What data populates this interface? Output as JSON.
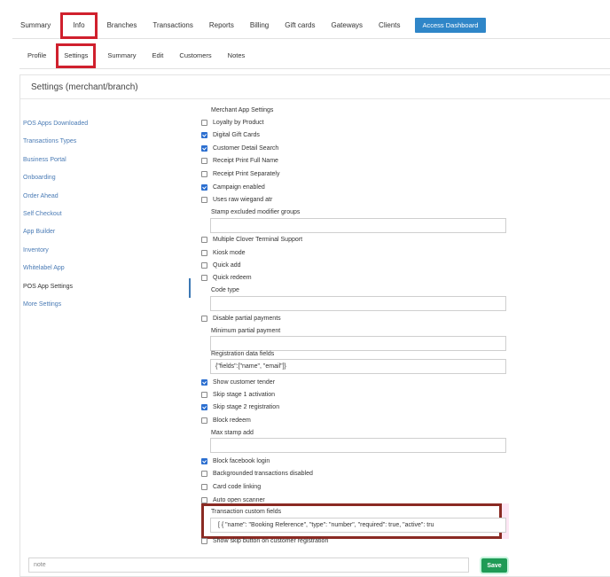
{
  "top_nav": {
    "tabs": [
      "Summary",
      "Info",
      "Branches",
      "Transactions",
      "Reports",
      "Billing",
      "Gift cards",
      "Gateways",
      "Clients"
    ],
    "active": "Info",
    "access_button": "Access Dashboard"
  },
  "sub_nav": {
    "tabs": [
      "Profile",
      "Settings",
      "Summary",
      "Edit",
      "Customers",
      "Notes"
    ],
    "active": "Settings"
  },
  "panel": {
    "title": "Settings (merchant/branch)"
  },
  "sidebar": {
    "items": [
      "POS Apps Downloaded",
      "Transactions Types",
      "Business Portal",
      "Onboarding",
      "Order Ahead",
      "Self Checkout",
      "App Builder",
      "Inventory",
      "Whitelabel App",
      "POS App Settings",
      "More Settings"
    ],
    "current": "POS App Settings"
  },
  "settings": {
    "section_title": "Merchant App Settings",
    "checkboxes": [
      {
        "label": "Loyalty by Product",
        "checked": false
      },
      {
        "label": "Digital Gift Cards",
        "checked": true
      },
      {
        "label": "Customer Detail Search",
        "checked": true
      },
      {
        "label": "Receipt Print Full Name",
        "checked": false
      },
      {
        "label": "Receipt Print Separately",
        "checked": false
      },
      {
        "label": "Campaign enabled",
        "checked": true
      },
      {
        "label": "Uses raw wiegand atr",
        "checked": false
      },
      {
        "label": "Multiple Clover Terminal Support",
        "checked": false
      },
      {
        "label": "Kiosk mode",
        "checked": false
      },
      {
        "label": "Quick add",
        "checked": false
      },
      {
        "label": "Quick redeem",
        "checked": false
      },
      {
        "label": "Disable partial payments",
        "checked": false
      },
      {
        "label": "Show customer tender",
        "checked": true
      },
      {
        "label": "Skip stage 1 activation",
        "checked": false
      },
      {
        "label": "Skip stage 2 registration",
        "checked": true
      },
      {
        "label": "Block redeem",
        "checked": false
      },
      {
        "label": "Block facebook login",
        "checked": true
      },
      {
        "label": "Backgrounded transactions disabled",
        "checked": false
      },
      {
        "label": "Card code linking",
        "checked": false
      },
      {
        "label": "Auto open scanner",
        "checked": false
      },
      {
        "label": "Show skip button on customer registration",
        "checked": false
      }
    ],
    "fields": {
      "stamp_excluded": {
        "label": "Stamp excluded modifier groups",
        "value": ""
      },
      "code_type": {
        "label": "Code type",
        "value": ""
      },
      "min_partial": {
        "label": "Minimum partial payment",
        "value": ""
      },
      "registration_fields": {
        "label": "Registration data fields",
        "value": "{\"fields\":[\"name\", \"email\"]}"
      },
      "max_stamp": {
        "label": "Max stamp add",
        "value": ""
      },
      "transaction_custom": {
        "label": "Transaction custom fields",
        "value": "[    {        \"name\": \"Booking Reference\",        \"type\": \"number\",        \"required\": true,        \"active\": tru"
      }
    }
  },
  "footer": {
    "note_placeholder": "note",
    "save_label": "Save"
  },
  "colors": {
    "highlight_red": "#d0202d",
    "highlight_dark_red": "#8a2a23",
    "link_blue": "#4a7bb5",
    "access_blue": "#2f86c8",
    "save_green": "#1f9b56"
  }
}
